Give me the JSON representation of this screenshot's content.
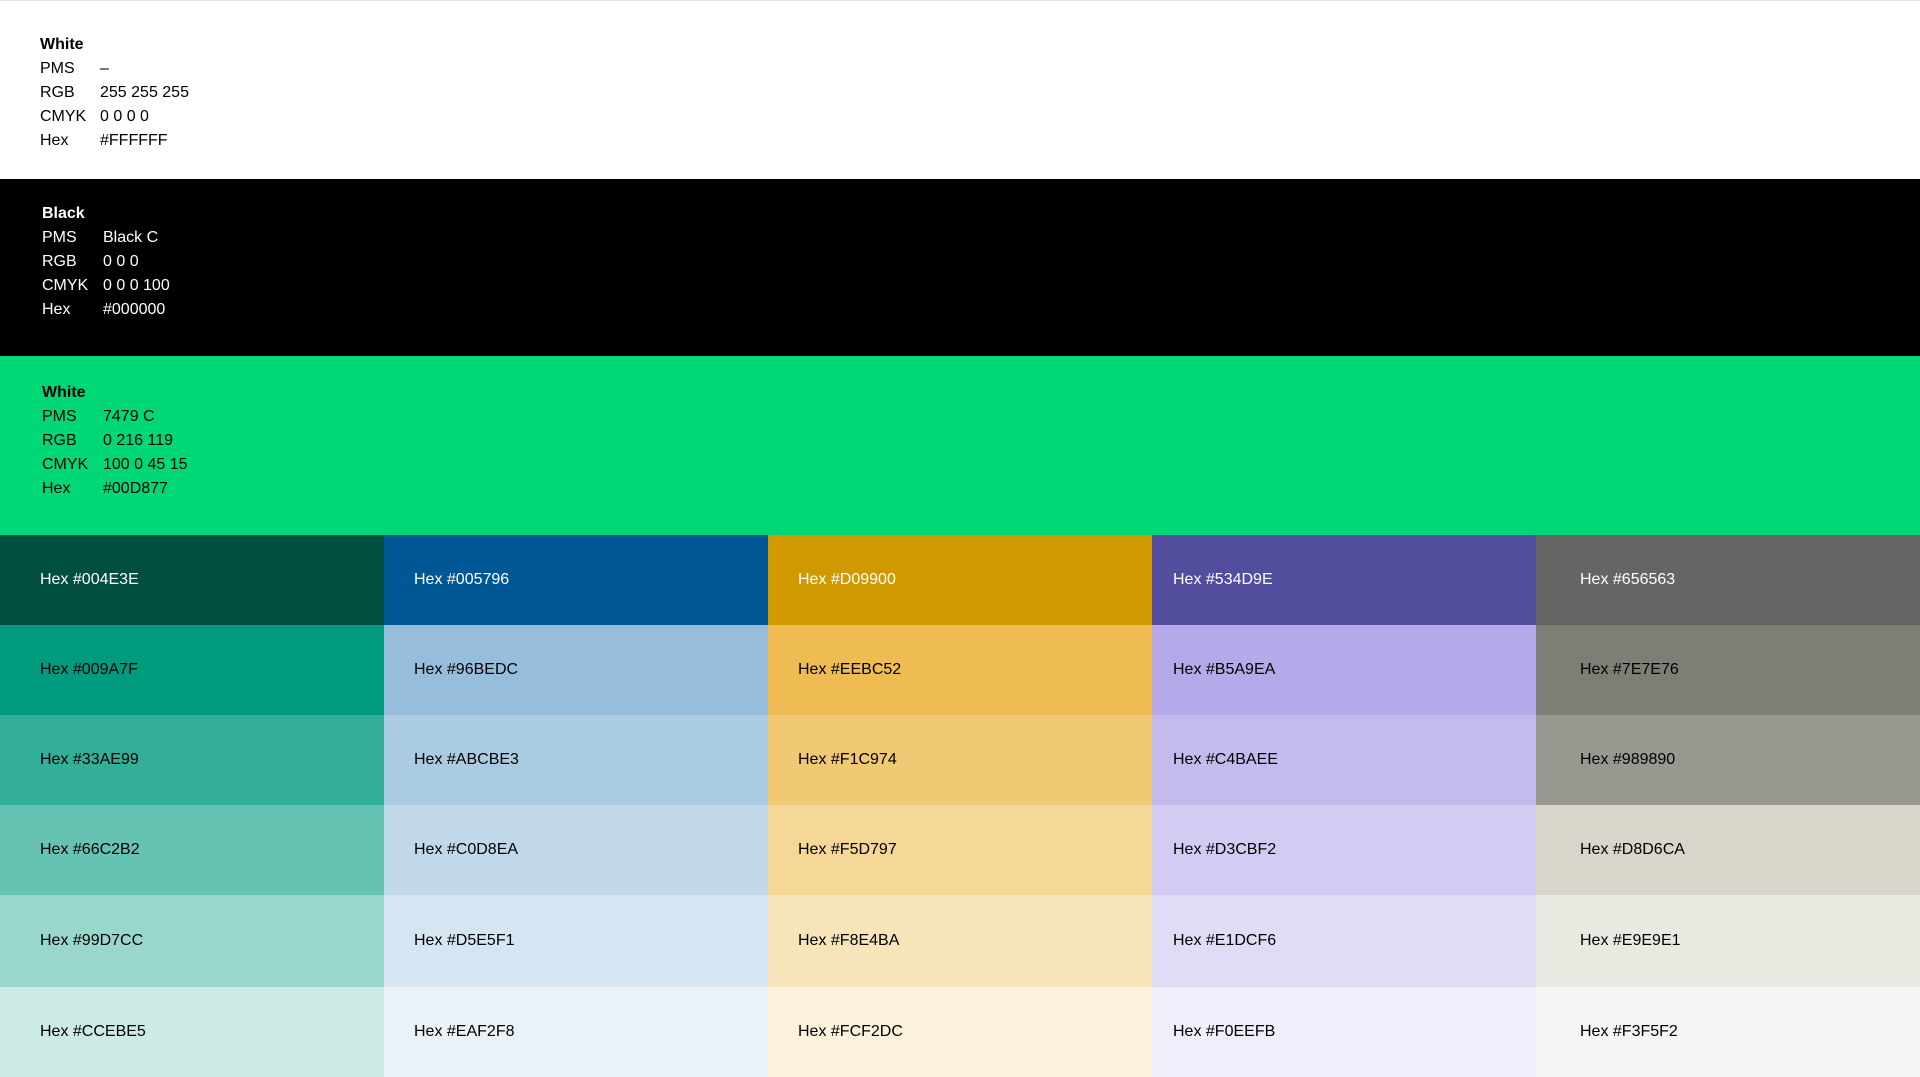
{
  "spec_blocks": [
    {
      "name": "White",
      "rows": [
        {
          "key": "PMS",
          "value": "–"
        },
        {
          "key": "RGB",
          "value": "255 255 255"
        },
        {
          "key": "CMYK",
          "value": "0 0 0 0"
        },
        {
          "key": "Hex",
          "value": "#FFFFFF"
        }
      ]
    },
    {
      "name": "Black",
      "rows": [
        {
          "key": "PMS",
          "value": "Black C"
        },
        {
          "key": "RGB",
          "value": "0 0 0"
        },
        {
          "key": "CMYK",
          "value": "0 0 0 100"
        },
        {
          "key": "Hex",
          "value": "#000000"
        }
      ]
    },
    {
      "name": "White",
      "rows": [
        {
          "key": "PMS",
          "value": "7479 C"
        },
        {
          "key": "RGB",
          "value": "0 216 119"
        },
        {
          "key": "CMYK",
          "value": "100 0 45 15"
        },
        {
          "key": "Hex",
          "value": "#00D877"
        }
      ]
    }
  ],
  "swatch_rows": [
    [
      {
        "label": "Hex #004E3E",
        "color": "#004E3E",
        "text_color": "#ffffff"
      },
      {
        "label": "Hex #005796",
        "color": "#005796",
        "text_color": "#ffffff"
      },
      {
        "label": "Hex #D09900",
        "color": "#D09900",
        "text_color": "#ffffff"
      },
      {
        "label": "Hex #534D9E",
        "color": "#534D9E",
        "text_color": "#ffffff"
      },
      {
        "label": "Hex #656563",
        "color": "#656563",
        "text_color": "#ffffff"
      }
    ],
    [
      {
        "label": "Hex #009A7F",
        "color": "#009A7F",
        "text_color": "#000000"
      },
      {
        "label": "Hex #96BEDC",
        "color": "#96BEDC",
        "text_color": "#000000"
      },
      {
        "label": "Hex #EEBC52",
        "color": "#EEBC52",
        "text_color": "#000000"
      },
      {
        "label": "Hex #B5A9EA",
        "color": "#B5A9EA",
        "text_color": "#000000"
      },
      {
        "label": "Hex #7E7E76",
        "color": "#7E7E76",
        "text_color": "#000000"
      }
    ],
    [
      {
        "label": "Hex #33AE99",
        "color": "#33AE99",
        "text_color": "#000000"
      },
      {
        "label": "Hex #ABCBE3",
        "color": "#ABCBE3",
        "text_color": "#000000"
      },
      {
        "label": "Hex #F1C974",
        "color": "#F1C974",
        "text_color": "#000000"
      },
      {
        "label": "Hex #C4BAEE",
        "color": "#C4BAEE",
        "text_color": "#000000"
      },
      {
        "label": "Hex #989890",
        "color": "#989890",
        "text_color": "#000000"
      }
    ],
    [
      {
        "label": "Hex #66C2B2",
        "color": "#66C2B2",
        "text_color": "#000000"
      },
      {
        "label": "Hex #C0D8EA",
        "color": "#C0D8EA",
        "text_color": "#000000"
      },
      {
        "label": "Hex #F5D797",
        "color": "#F5D797",
        "text_color": "#000000"
      },
      {
        "label": "Hex #D3CBF2",
        "color": "#D3CBF2",
        "text_color": "#000000"
      },
      {
        "label": "Hex #D8D6CA",
        "color": "#D8D6CA",
        "text_color": "#000000"
      }
    ],
    [
      {
        "label": "Hex #99D7CC",
        "color": "#99D7CC",
        "text_color": "#000000"
      },
      {
        "label": "Hex #D5E5F1",
        "color": "#D5E5F1",
        "text_color": "#000000"
      },
      {
        "label": "Hex #F8E4BA",
        "color": "#F8E4BA",
        "text_color": "#000000"
      },
      {
        "label": "Hex #E1DCF6",
        "color": "#E1DCF6",
        "text_color": "#000000"
      },
      {
        "label": "Hex #E9E9E1",
        "color": "#E9E9E1",
        "text_color": "#000000"
      }
    ],
    [
      {
        "label": "Hex #CCEBE5",
        "color": "#CCEBE5",
        "text_color": "#000000"
      },
      {
        "label": "Hex #EAF2F8",
        "color": "#EAF2F8",
        "text_color": "#000000"
      },
      {
        "label": "Hex #FCF2DC",
        "color": "#FCF2DC",
        "text_color": "#000000"
      },
      {
        "label": "Hex #F0EEFB",
        "color": "#F0EEFB",
        "text_color": "#000000"
      },
      {
        "label": "Hex #F3F5F2",
        "color": "#F3F5F2",
        "text_color": "#000000"
      }
    ]
  ]
}
